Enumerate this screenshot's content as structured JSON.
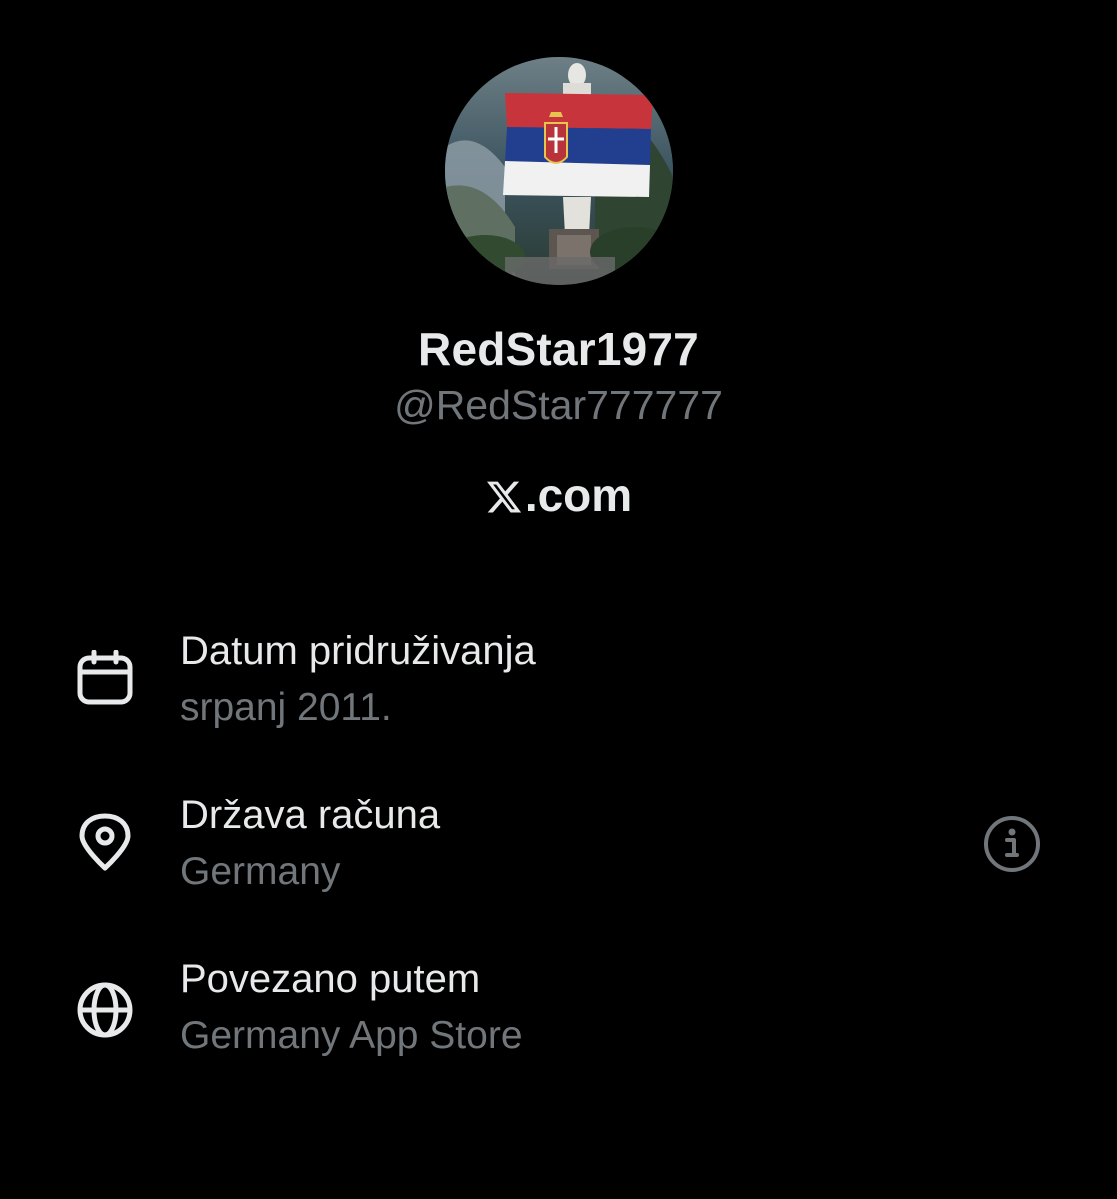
{
  "profile": {
    "display_name": "RedStar1977",
    "handle": "@RedStar777777",
    "avatar_icon": "profile-avatar-serbian-flag-statue"
  },
  "brand": {
    "label": ".com",
    "logo_icon": "x-logo-icon"
  },
  "details": [
    {
      "icon": "calendar-icon",
      "label": "Datum pridruživanja",
      "value": "srpanj 2011."
    },
    {
      "icon": "location-pin-icon",
      "label": "Država računa",
      "value": "Germany",
      "action_icon": "info-icon"
    },
    {
      "icon": "globe-icon",
      "label": "Povezano putem",
      "value": "Germany App Store"
    }
  ],
  "colors": {
    "background": "#000000",
    "primary_text": "#e7e9ea",
    "secondary_text": "#71767b"
  }
}
